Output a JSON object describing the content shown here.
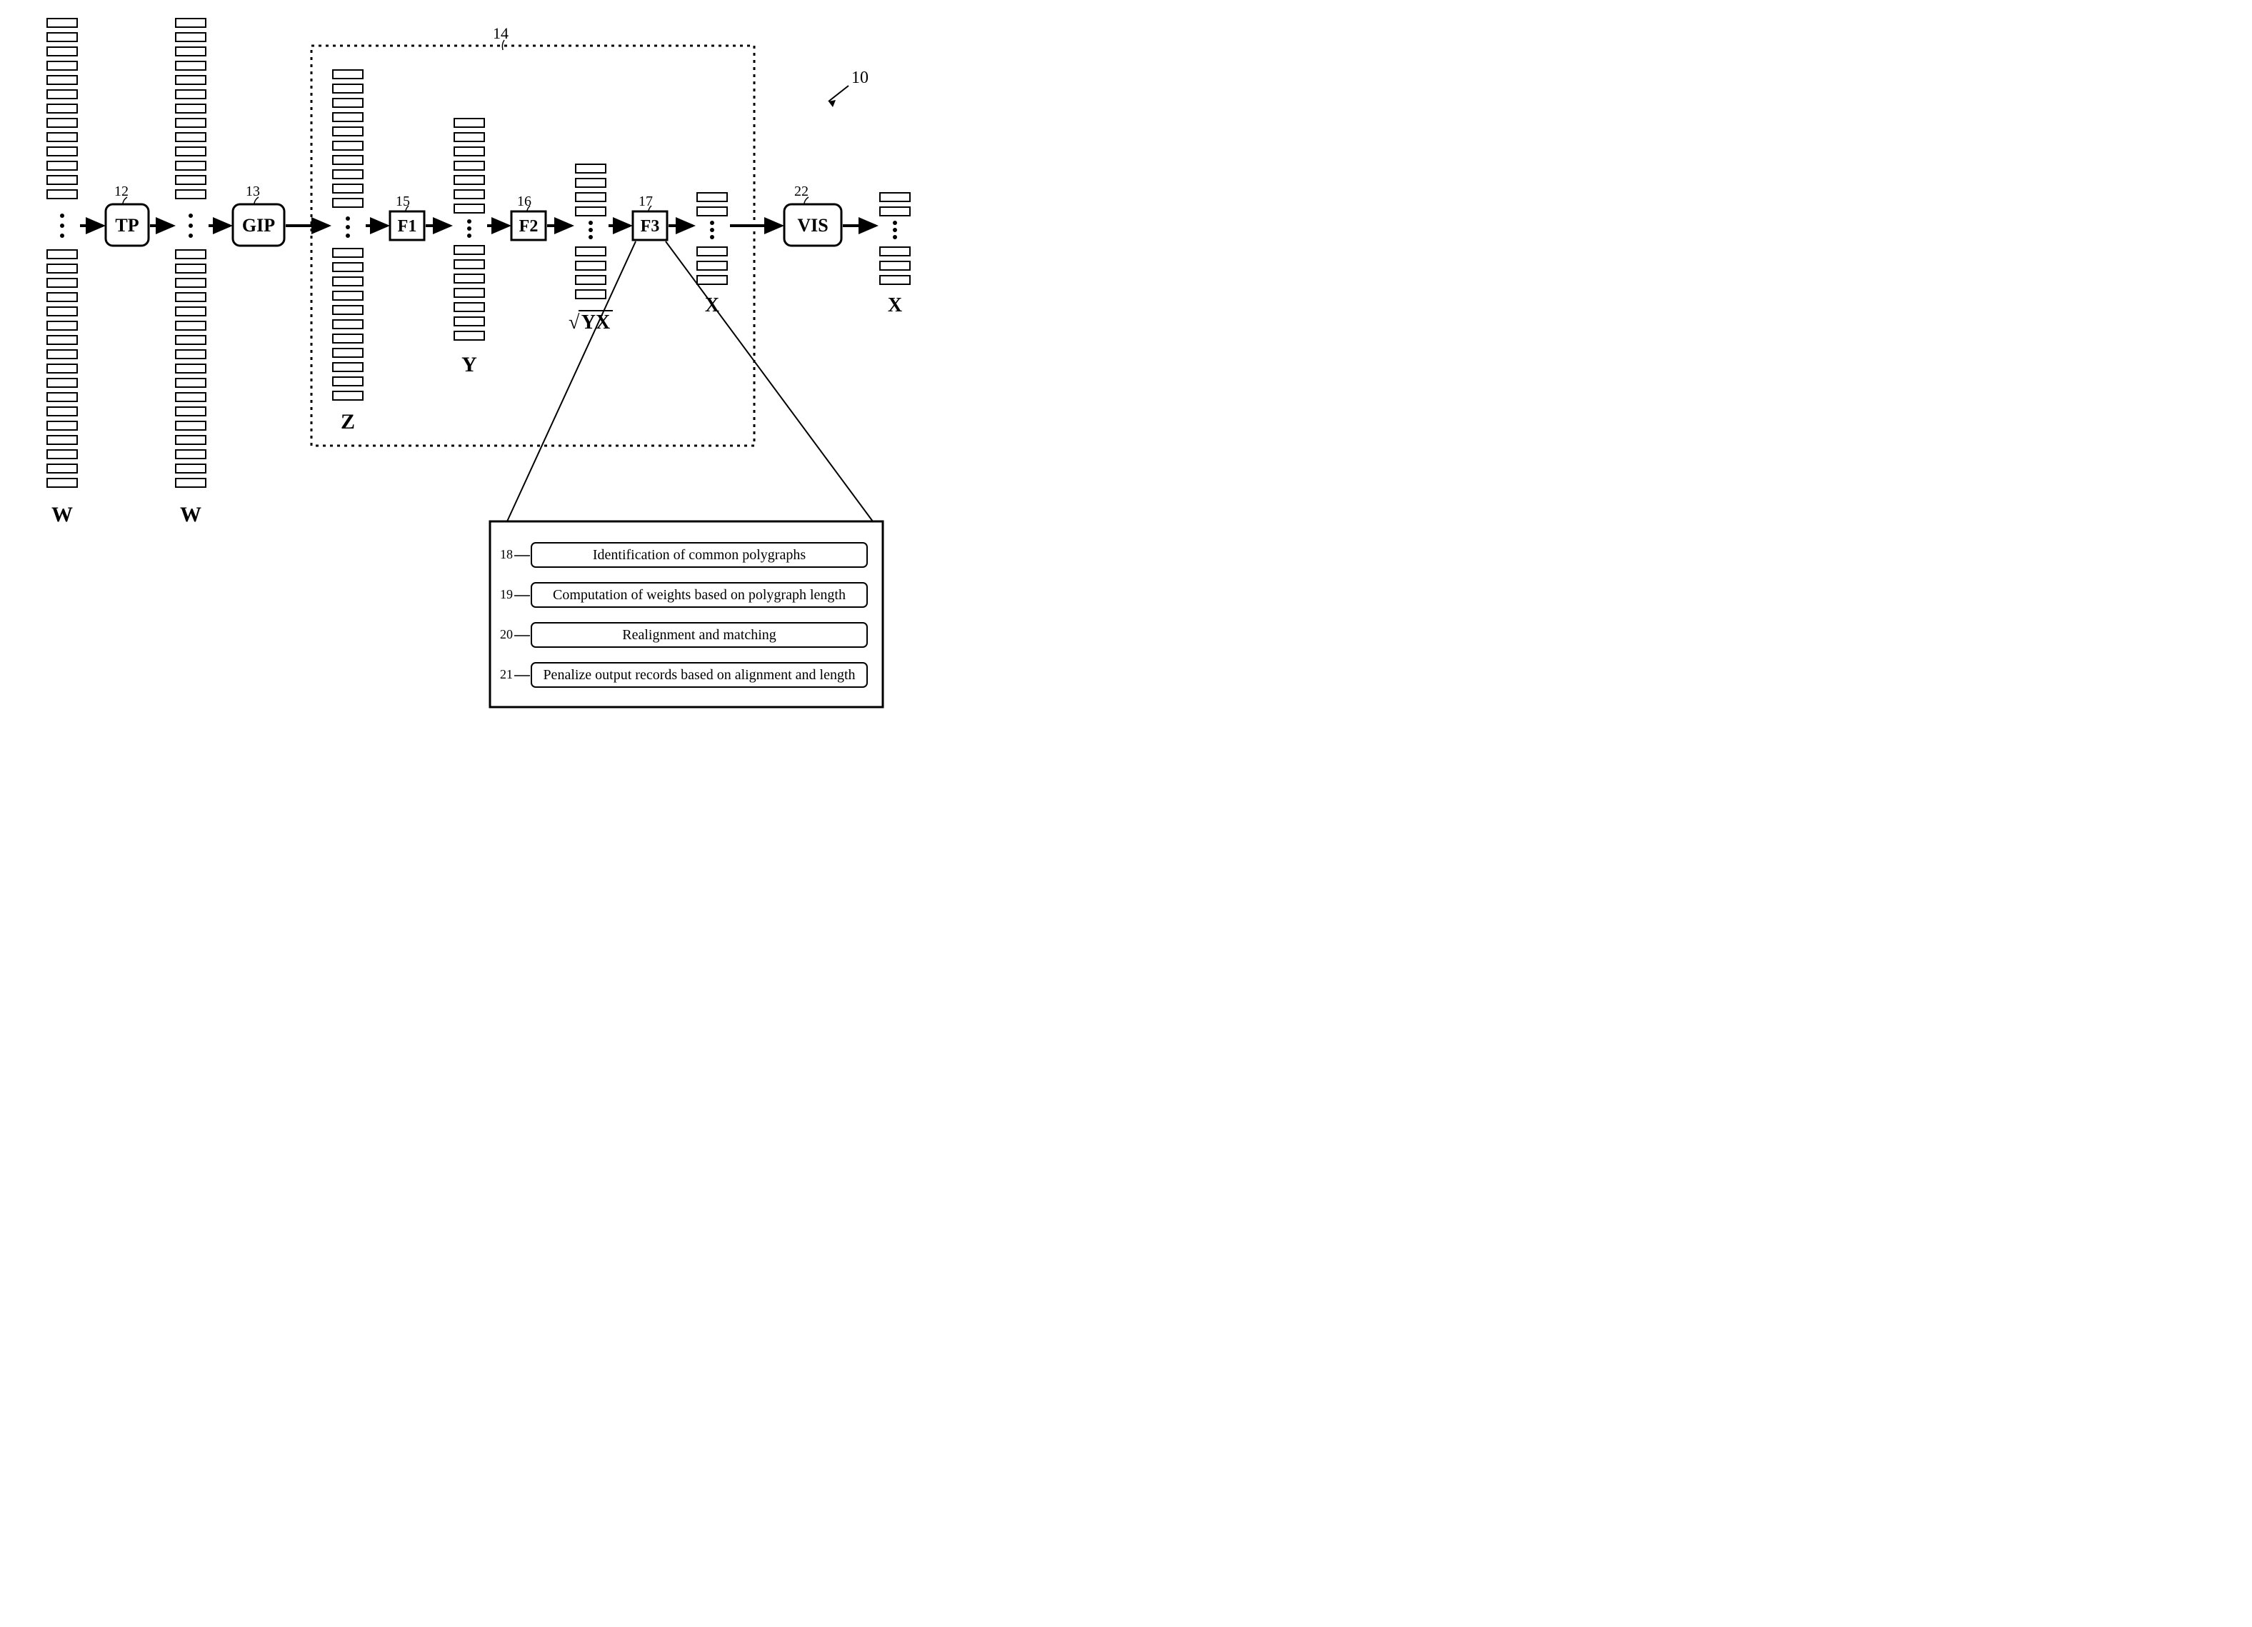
{
  "refs": {
    "system": "10",
    "tp": "12",
    "gip": "13",
    "dotted": "14",
    "f1": "15",
    "f2": "16",
    "f3": "17",
    "step18": "18",
    "step19": "19",
    "step20": "20",
    "step21": "21",
    "vis": "22"
  },
  "boxes": {
    "tp": "TP",
    "gip": "GIP",
    "f1": "F1",
    "f2": "F2",
    "f3": "F3",
    "vis": "VIS"
  },
  "stackLabels": {
    "w1": "W",
    "w2": "W",
    "z": "Z",
    "y": "Y",
    "sqrtYX": "√YX",
    "x1": "X",
    "x2": "X"
  },
  "steps": {
    "s18": "Identification of common polygraphs",
    "s19": "Computation of weights based on polygraph length",
    "s20": "Realignment and matching",
    "s21": "Penalize output records based on alignment and length"
  }
}
